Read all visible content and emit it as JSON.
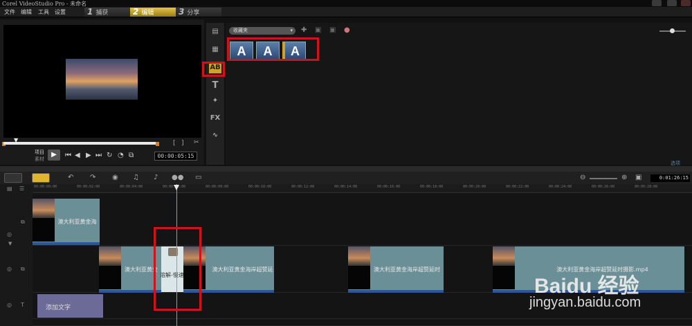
{
  "app": {
    "title": "Corel VideoStudio Pro - 未命名"
  },
  "menu": [
    "文件",
    "编辑",
    "工具",
    "设置"
  ],
  "steps": [
    {
      "num": "1",
      "label": "捕获"
    },
    {
      "num": "2",
      "label": "编辑"
    },
    {
      "num": "3",
      "label": "分享"
    }
  ],
  "preview": {
    "mode_project": "项目",
    "mode_clip": "素材",
    "timecode": "00:00:05:15"
  },
  "library": {
    "dropdown_value": "收藏夹",
    "titles": [
      "A",
      "A",
      "A"
    ],
    "bottom_link": "选项"
  },
  "timeline": {
    "timecode": "0:01:26:15",
    "ruler": [
      "00:00:00:00",
      "00:00:02:00",
      "00:00:04:00",
      "00:00:06:00",
      "00:00:08:00",
      "00:00:10:00",
      "00:00:12:00",
      "00:00:14:00",
      "00:00:16:00",
      "00:00:18:00",
      "00:00:20:00",
      "00:00:22:00",
      "00:00:24:00",
      "00:00:26:00",
      "00:00:28:00"
    ],
    "overlay_clip": "澳大利亚黄金海",
    "video_clips": [
      "澳大利亚黄金",
      "澳大利亚黄金海岸超赞延",
      "澳大利亚黄金海岸超赞延时",
      "澳大利亚黄金海岸超赞延时摄影.mp4"
    ],
    "transition_label": "溶解-慢速",
    "text_clip": "添加文字"
  },
  "watermark": {
    "logo": "Baidu 经验",
    "url": "jingyan.baidu.com"
  },
  "colors": {
    "accent": "#e0b42c",
    "highlight_box": "#d0121b",
    "clip": "#6a8f97",
    "text_clip": "#6c6a96"
  }
}
